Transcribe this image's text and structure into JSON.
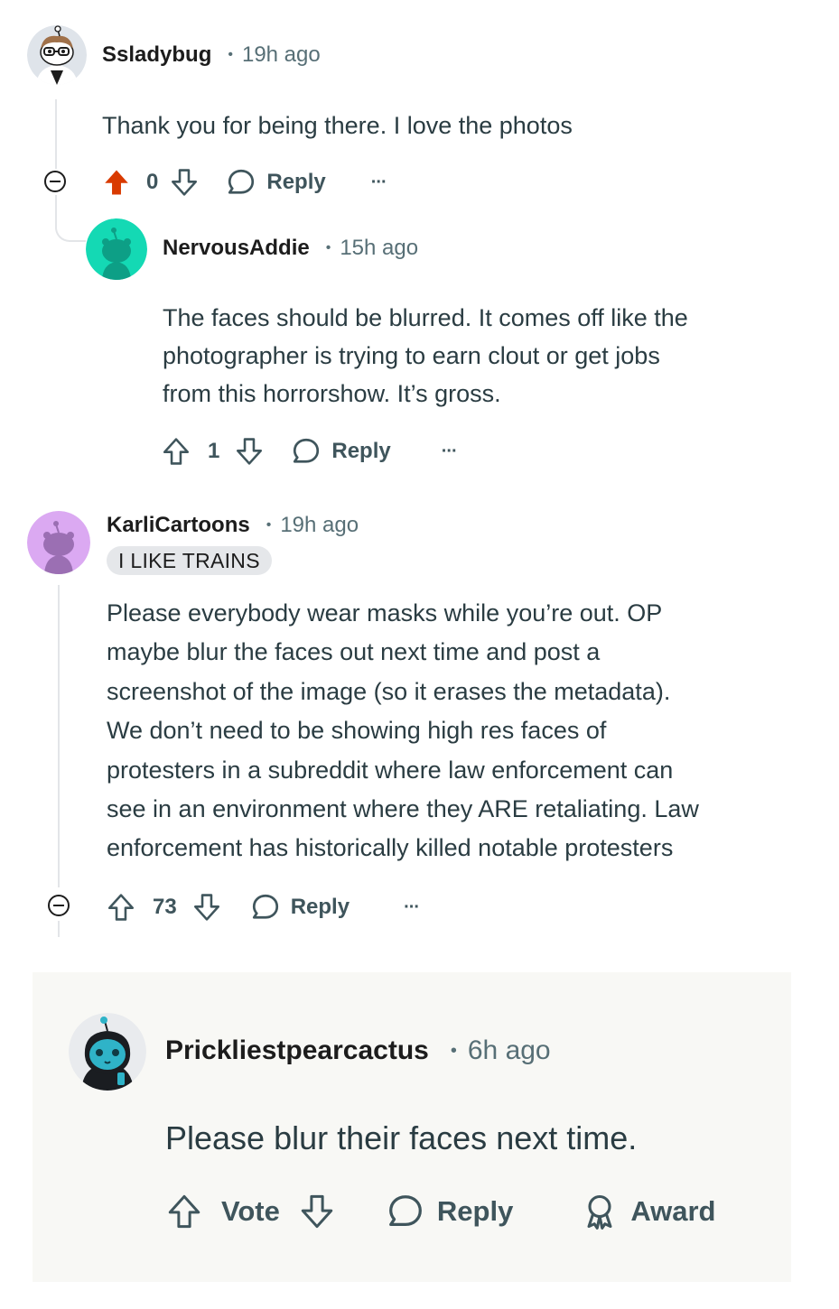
{
  "comments": [
    {
      "username": "Ssladybug",
      "time": "19h ago",
      "dot": "•",
      "body": "Thank you for being there. I love the photos",
      "score": "0",
      "reply_label": "Reply",
      "more_label": "···",
      "upvoted": true,
      "avatar_bg": "#dfe4ea"
    },
    {
      "username": "NervousAddie",
      "time": "15h ago",
      "dot": "•",
      "body_lines": [
        "The faces should be blurred. It comes off like the",
        "photographer is trying to earn clout or get jobs",
        "from this horrorshow. It’s gross."
      ],
      "score": "1",
      "reply_label": "Reply",
      "more_label": "···",
      "avatar_bg": "#14d9b4"
    },
    {
      "username": "KarliCartoons",
      "time": "19h ago",
      "dot": "•",
      "flair": "I LIKE TRAINS",
      "body_lines": [
        "Please everybody wear masks while you’re out. OP",
        "maybe blur the faces out next time and post a",
        "screenshot of the image (so it erases the metadata).",
        "We don’t need to be showing high res faces of",
        "protesters in a subreddit where law enforcement can",
        "see in an environment where they ARE retaliating. Law",
        "enforcement has historically killed notable protesters"
      ],
      "score": "73",
      "reply_label": "Reply",
      "more_label": "···",
      "avatar_bg": "#dba9f2"
    }
  ],
  "composer_card": {
    "username": "Prickliestpearcactus",
    "time": "6h ago",
    "dot": "•",
    "body": "Please blur their faces next time.",
    "vote_label": "Vote",
    "reply_label": "Reply",
    "award_label": "Award",
    "avatar_bg": "#e9ebee"
  },
  "colors": {
    "upvote_active": "#d93a00",
    "meta_gray": "#576f76",
    "thread_line": "#e3e5e8",
    "card_bg": "#f8f8f5"
  }
}
